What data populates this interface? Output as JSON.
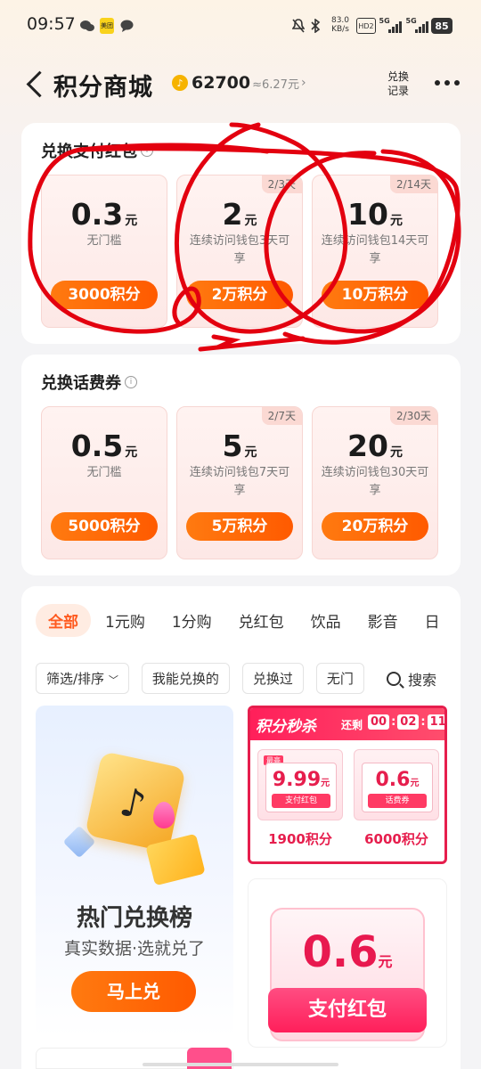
{
  "status_bar": {
    "time": "09:57",
    "meituan": "美团",
    "speed_value": "83.0",
    "speed_unit": "KB/s",
    "hd": "HD2",
    "sig1_label": "5G",
    "sig2_label": "5G",
    "battery": "85"
  },
  "header": {
    "title": "积分商城",
    "points": "62700",
    "points_value": "≈6.27元",
    "record_label": "兑换\n记录"
  },
  "section_redpacket": {
    "title": "兑换支付红包",
    "coupons": [
      {
        "amount": "0.3",
        "unit": "元",
        "tag": "",
        "desc": "无门槛",
        "price": "3000积分"
      },
      {
        "amount": "2",
        "unit": "元",
        "tag": "2/3天",
        "desc": "连续访问钱包3天可享",
        "price": "2万积分"
      },
      {
        "amount": "10",
        "unit": "元",
        "tag": "2/14天",
        "desc": "连续访问钱包14天可享",
        "price": "10万积分"
      }
    ]
  },
  "section_phone": {
    "title": "兑换话费券",
    "coupons": [
      {
        "amount": "0.5",
        "unit": "元",
        "tag": "",
        "desc": "无门槛",
        "price": "5000积分"
      },
      {
        "amount": "5",
        "unit": "元",
        "tag": "2/7天",
        "desc": "连续访问钱包7天可享",
        "price": "5万积分"
      },
      {
        "amount": "20",
        "unit": "元",
        "tag": "2/30天",
        "desc": "连续访问钱包30天可享",
        "price": "20万积分"
      }
    ]
  },
  "tabs": [
    "全部",
    "1元购",
    "1分购",
    "兑红包",
    "饮品",
    "影音",
    "日"
  ],
  "filters": [
    "筛选/排序",
    "我能兑换的",
    "兑换过",
    "无门"
  ],
  "search_label": "搜索",
  "hot_rank": {
    "title": "热门兑换榜",
    "subtitle": "真实数据·选就兑了",
    "button": "马上兑"
  },
  "flash_sale": {
    "title": "积分秒杀",
    "remain_label": "还剩",
    "timer": [
      "00",
      "02",
      "11"
    ],
    "items": [
      {
        "badge": "最高",
        "amount": "9.99",
        "unit": "元",
        "label": "支付红包",
        "price": "1900积分"
      },
      {
        "badge": "",
        "amount": "0.6",
        "unit": "元",
        "label": "话费券",
        "price": "6000积分"
      }
    ]
  },
  "promo": {
    "amount": "0.6",
    "unit": "元",
    "label": "支付红包"
  },
  "colors": {
    "accent_orange": "#ff5a00",
    "flash_red": "#e61e4d",
    "annotation_red": "#e3000f"
  }
}
